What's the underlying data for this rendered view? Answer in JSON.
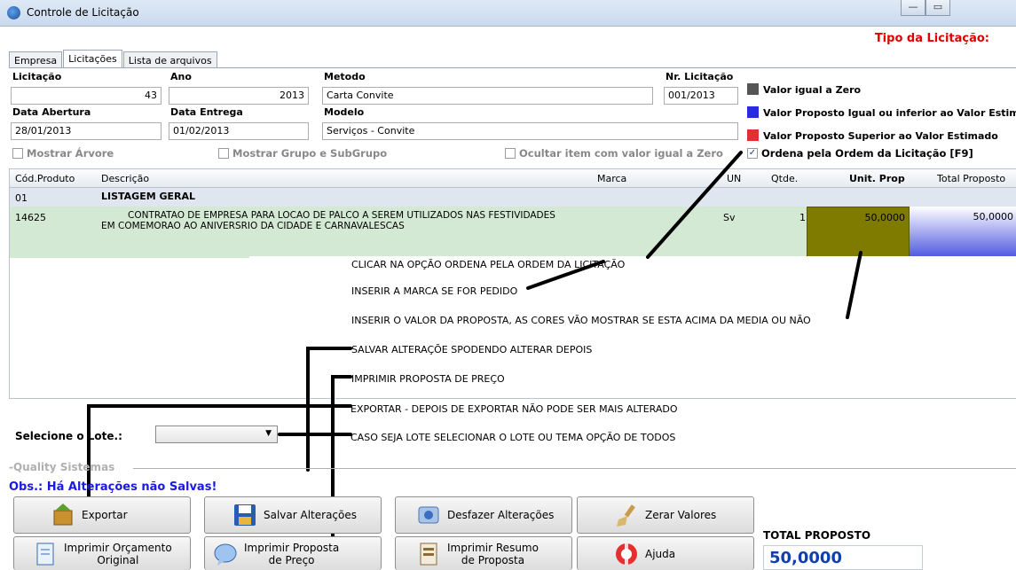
{
  "window": {
    "title": "Controle de Licitação",
    "minimize": "—",
    "maximize": "▭"
  },
  "tipo_label": "Tipo da Licitação:",
  "tabs": [
    {
      "label": "Empresa"
    },
    {
      "label": "Licitações"
    },
    {
      "label": "Lista de arquivos"
    }
  ],
  "form": {
    "licitacao_label": "Licitação",
    "licitacao_value": "43",
    "ano_label": "Ano",
    "ano_value": "2013",
    "metodo_label": "Metodo",
    "metodo_value": "Carta Convite",
    "nr_label": "Nr. Licitação",
    "nr_value": "001/2013",
    "abertura_label": "Data Abertura",
    "abertura_value": "28/01/2013",
    "entrega_label": "Data Entrega",
    "entrega_value": "01/02/2013",
    "modelo_label": "Modelo",
    "modelo_value": "Serviços - Convite"
  },
  "legend": [
    {
      "text": "Valor igual a Zero",
      "color": "#555555"
    },
    {
      "text": "Valor Proposto Igual ou inferior ao Valor Estima",
      "color": "#2a2ae0"
    },
    {
      "text": "Valor Proposto Superior ao Valor Estimado",
      "color": "#e03030"
    }
  ],
  "checkboxes": {
    "arvore": "Mostrar Árvore",
    "grupo": "Mostrar Grupo e SubGrupo",
    "ocultar": "Ocultar item com valor igual a Zero",
    "ordena": "Ordena pela Ordem da Licitação [F9]",
    "ordena_check": "✓"
  },
  "grid": {
    "headers": {
      "cod": "Cód.Produto",
      "desc": "Descrição",
      "marca": "Marca",
      "un": "UN",
      "qtde": "Qtde.",
      "unit": "Unit. Prop",
      "total": "Total Proposto"
    },
    "group_row": {
      "cod": "01",
      "desc": "LISTAGEM GERAL"
    },
    "item_row": {
      "cod": "14625",
      "desc_line1": "CONTRATAO DE EMPRESA PARA LOCAO DE PALCO A SEREM UTILIZADOS NAS FESTIVIDADES",
      "desc_line2": "EM COMEMORAO AO ANIVERSRIO DA CIDADE E CARNAVALESCAS",
      "un": "Sv",
      "qtde": "1",
      "unit": "50,0000",
      "total": "50,0000"
    }
  },
  "instructions": [
    "CLICAR NA OPÇÃO ORDENA PELA ORDEM DA LICITAÇÃO",
    "INSERIR A MARCA SE FOR PEDIDO",
    "INSERIR O VALOR DA PROPOSTA, AS CORES VÃO MOSTRAR SE ESTA ACIMA DA MEDIA OU NÃO",
    "SALVAR ALTERAÇÕE SPODENDO ALTERAR DEPOIS",
    "IMPRIMIR PROPOSTA DE PREÇO",
    "EXPORTAR - DEPOIS DE EXPORTAR NÃO PODE SER MAIS ALTERADO",
    "CASO SEJA LOTE SELECIONAR O LOTE OU TEMA OPÇÃO DE TODOS"
  ],
  "lote": {
    "label": "Selecione o Lote.:",
    "value": "",
    "arrow": "▼"
  },
  "footer": {
    "quality": "-Quality Sistemas",
    "obs": "Obs.: Há Alterações não Salvas!",
    "buttons": {
      "exportar": "Exportar",
      "salvar": "Salvar Alterações",
      "desfazer": "Desfazer Alterações",
      "zerar": "Zerar Valores",
      "orcamento_1": "Imprimir Orçamento",
      "orcamento_2": "Original",
      "proposta_1": "Imprimir Proposta",
      "proposta_2": "de Preço",
      "resumo_1": "Imprimir Resumo",
      "resumo_2": "de Proposta",
      "ajuda": "Ajuda"
    },
    "total_label": "TOTAL PROPOSTO",
    "total_value": "50,0000"
  }
}
